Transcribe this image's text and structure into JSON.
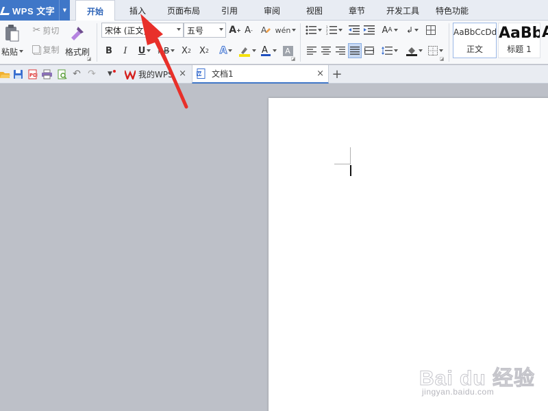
{
  "app": {
    "name": "WPS 文字"
  },
  "menu_tabs": [
    "开始",
    "插入",
    "页面布局",
    "引用",
    "审阅",
    "视图",
    "章节",
    "开发工具",
    "特色功能"
  ],
  "ribbon": {
    "paste_label": "粘贴",
    "cut_label": "剪切",
    "copy_label": "复制",
    "format_painter_label": "格式刷",
    "font_name": "宋体 (正文)",
    "font_size": "五号",
    "styles": [
      {
        "preview": "AaBbCcDd",
        "name": "正文"
      },
      {
        "preview": "AaBb",
        "name": "标题 1"
      }
    ],
    "style_partial": "A",
    "colors": {
      "highlight": "#f5e20b",
      "font_color": "#d81e06",
      "underline_blue": "#1f4fbf"
    }
  },
  "doc_tabs": [
    {
      "label": "我的WPS",
      "active": false
    },
    {
      "label": "文档1",
      "active": true
    }
  ],
  "watermark": {
    "brand": "Bai du 经验",
    "url": "jingyan.baidu.com"
  },
  "colors": {
    "accent": "#3f77c8",
    "arrow": "#e8302a"
  }
}
